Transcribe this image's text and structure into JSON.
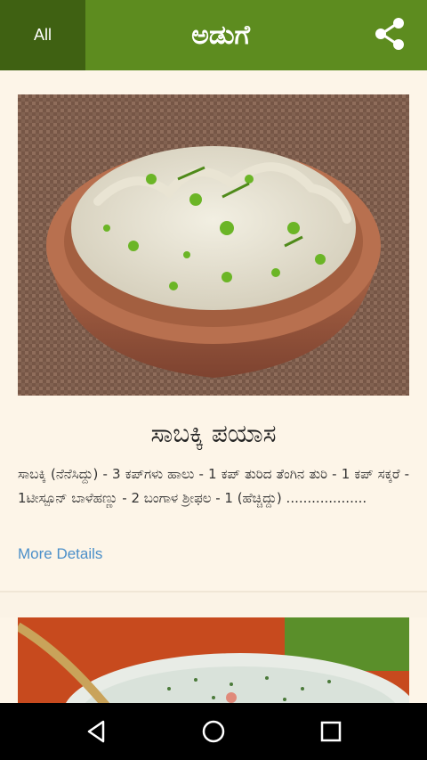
{
  "header": {
    "all_tab": "All",
    "title": "ಅಡುಗೆ",
    "share_icon": "share-icon",
    "bar_color": "#5d8c1f",
    "tab_color": "#3f6112"
  },
  "recipes": [
    {
      "title": "ಸಾಬಕ್ಕಿ ಪಯಾಸ",
      "description": "ಸಾಬಕ್ಕಿ (ನೆನೆಸಿದ್ದು) - 3 ಕಪ್‌ಗಳು ಹಾಲು - 1 ಕಪ್ ತುರಿದ ತೆಂಗಿನ ತುರಿ - 1 ಕಪ್ ಸಕ್ಕರೆ - 1ಟೀಸ್ಪೂನ್ ಬಾಳೆಹಣ್ಣು - 2 ಬಂಗಾಳ ಶ್ರೀಫಲ - 1 (ಹೆಚ್ಚಿದ್ದು) ...................",
      "more_label": "More Details"
    }
  ],
  "navbar": {
    "back_icon": "back-icon",
    "home_icon": "home-icon",
    "recents_icon": "recents-icon"
  }
}
